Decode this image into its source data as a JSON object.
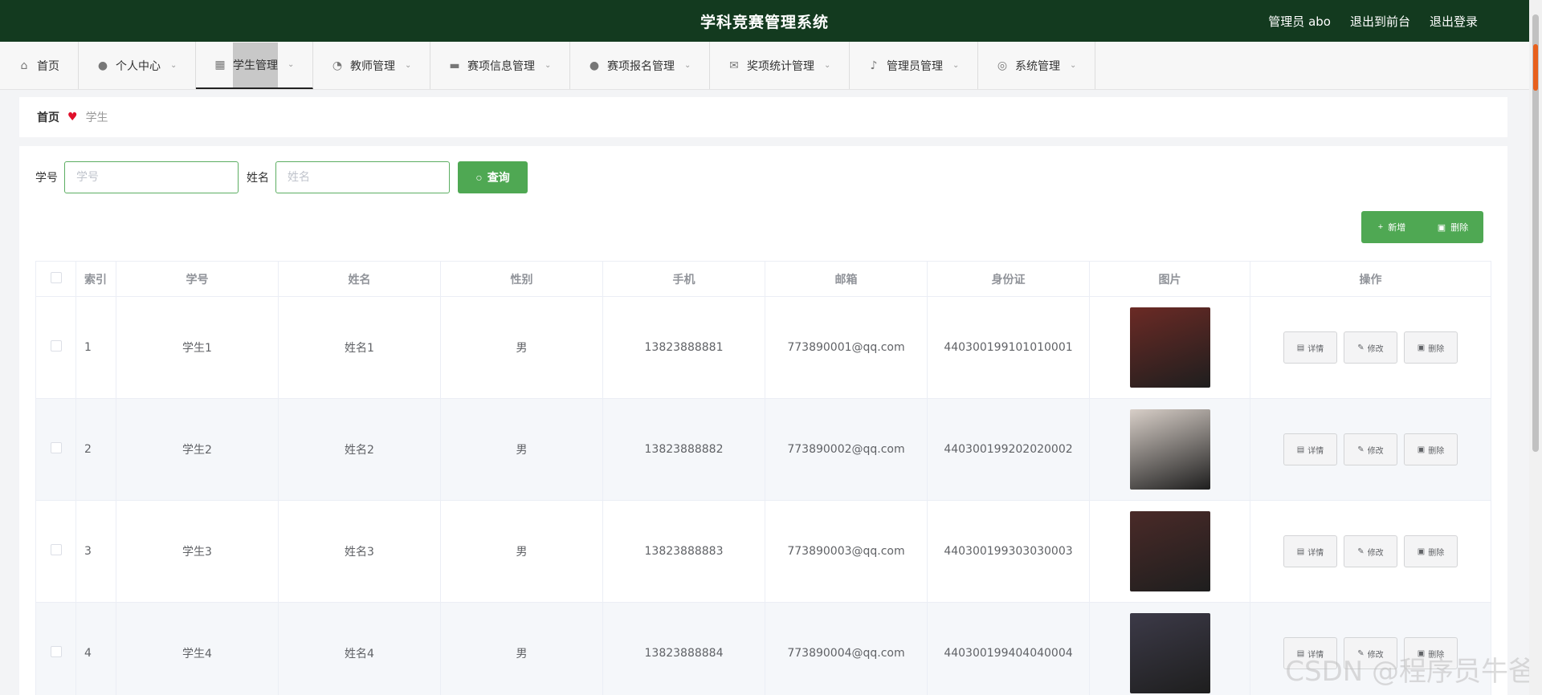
{
  "header": {
    "title": "学科竞赛管理系统",
    "user": "管理员 abo",
    "exit_front": "退出到前台",
    "logout": "退出登录"
  },
  "nav": [
    {
      "label": "首页",
      "icon": "home-icon",
      "glyph": "⌂",
      "chevron": false
    },
    {
      "label": "个人中心",
      "icon": "user-icon",
      "glyph": "●",
      "chevron": true
    },
    {
      "label": "学生管理",
      "icon": "grid-icon",
      "glyph": "▦",
      "chevron": true
    },
    {
      "label": "教师管理",
      "icon": "gauge-icon",
      "glyph": "◔",
      "chevron": true
    },
    {
      "label": "赛项信息管理",
      "icon": "chat-icon",
      "glyph": "▬",
      "chevron": true
    },
    {
      "label": "赛项报名管理",
      "icon": "bulb-icon",
      "glyph": "●",
      "chevron": true
    },
    {
      "label": "奖项统计管理",
      "icon": "mail-icon",
      "glyph": "✉",
      "chevron": true
    },
    {
      "label": "管理员管理",
      "icon": "mic-icon",
      "glyph": "♪",
      "chevron": true
    },
    {
      "label": "系统管理",
      "icon": "compass-icon",
      "glyph": "◎",
      "chevron": true
    }
  ],
  "breadcrumb": {
    "home": "首页",
    "current": "学生"
  },
  "search": {
    "student_no_label": "学号",
    "student_no_placeholder": "学号",
    "name_label": "姓名",
    "name_placeholder": "姓名",
    "query_label": "查询"
  },
  "toolbar": {
    "add_label": "新增",
    "delete_label": "删除"
  },
  "table": {
    "columns": [
      "索引",
      "学号",
      "姓名",
      "性别",
      "手机",
      "邮箱",
      "身份证",
      "图片",
      "操作"
    ],
    "op_labels": {
      "detail": "详情",
      "edit": "修改",
      "delete": "删除"
    },
    "rows": [
      {
        "index": "1",
        "student_no": "学生1",
        "name": "姓名1",
        "gender": "男",
        "phone": "13823888881",
        "email": "773890001@qq.com",
        "id_card": "440300199101010001",
        "photo_color": "#6b2a25"
      },
      {
        "index": "2",
        "student_no": "学生2",
        "name": "姓名2",
        "gender": "男",
        "phone": "13823888882",
        "email": "773890002@qq.com",
        "id_card": "440300199202020002",
        "photo_color": "#d8cfc8"
      },
      {
        "index": "3",
        "student_no": "学生3",
        "name": "姓名3",
        "gender": "男",
        "phone": "13823888883",
        "email": "773890003@qq.com",
        "id_card": "440300199303030003",
        "photo_color": "#4a2a28"
      },
      {
        "index": "4",
        "student_no": "学生4",
        "name": "姓名4",
        "gender": "男",
        "phone": "13823888884",
        "email": "773890004@qq.com",
        "id_card": "440300199404040004",
        "photo_color": "#3c3a48"
      }
    ]
  },
  "watermark": "CSDN @程序员牛爸"
}
